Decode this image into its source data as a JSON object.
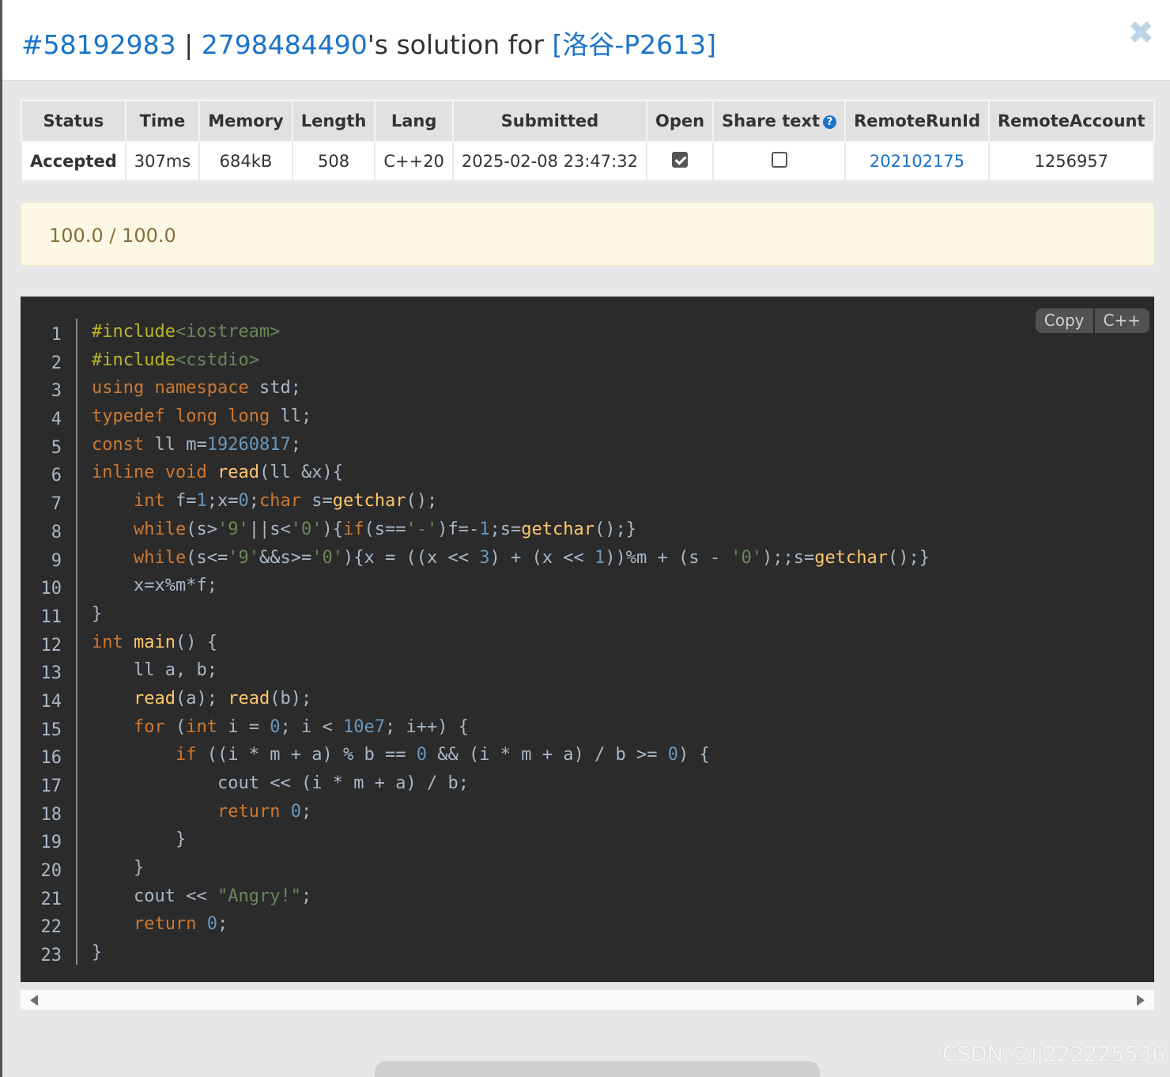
{
  "modal": {
    "submission_id": "#58192983",
    "separator": " | ",
    "user": "2798484490",
    "title_middle": "'s solution for ",
    "problem": "[洛谷-P2613]",
    "close_glyph": "✖"
  },
  "table": {
    "headers": [
      "Status",
      "Time",
      "Memory",
      "Length",
      "Lang",
      "Submitted",
      "Open",
      "Share text",
      "RemoteRunId",
      "RemoteAccount"
    ],
    "help_glyph": "?",
    "row": {
      "status": "Accepted",
      "time": "307ms",
      "memory": "684kB",
      "length": "508",
      "lang": "C++20",
      "submitted": "2025-02-08 23:47:32",
      "open_checked": true,
      "share_text_checked": false,
      "remote_run_id": "202102175",
      "remote_account": "1256957"
    },
    "colors": {
      "accepted": "#4cae4c",
      "link": "#1a73c8"
    }
  },
  "score": {
    "text": "100.0 / 100.0"
  },
  "code": {
    "copy_label": "Copy",
    "lang_label": "C++",
    "line_numbers": [
      "1",
      "2",
      "3",
      "4",
      "5",
      "6",
      "7",
      "8",
      "9",
      "10",
      "11",
      "12",
      "13",
      "14",
      "15",
      "16",
      "17",
      "18",
      "19",
      "20",
      "21",
      "22",
      "23"
    ],
    "lines": [
      "#include<iostream>",
      "#include<cstdio>",
      "using namespace std;",
      "typedef long long ll;",
      "const ll m=19260817;",
      "inline void read(ll &x){",
      "    int f=1;x=0;char s=getchar();",
      "    while(s>'9'||s<'0'){if(s=='-')f=-1;s=getchar();}",
      "    while(s<='9'&&s>='0'){x = ((x << 3) + (x << 1))%m + (s - '0');;s=getchar();}",
      "    x=x%m*f;",
      "}",
      "int main() {",
      "    ll a, b;",
      "    read(a); read(b);",
      "    for (int i = 0; i < 10e7; i++) {",
      "        if ((i * m + a) % b == 0 && (i * m + a) / b >= 0) {",
      "            cout << (i * m + a) / b;",
      "            return 0;",
      "        }",
      "    }",
      "    cout << \"Angry!\";",
      "    return 0;",
      "}"
    ],
    "theme": {
      "background": "#2b2b2b",
      "keyword": "#cc7832",
      "function": "#ffc66d",
      "number": "#6897bb",
      "string": "#6a8759"
    }
  },
  "watermark": {
    "text": "CSDN @lj222225536"
  }
}
